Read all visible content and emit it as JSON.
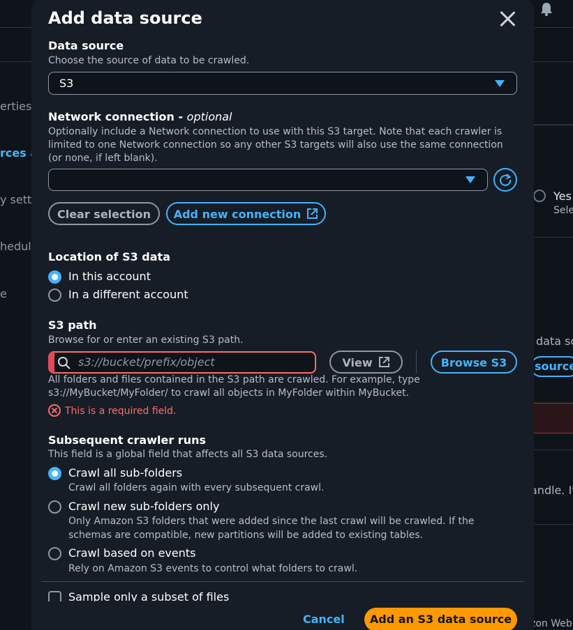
{
  "background": {
    "sidebar_items": [
      "erties",
      "rces an",
      "y setti",
      "hedul",
      "e"
    ],
    "yes_label": "Yes",
    "sel_label": "Sele",
    "data_so_label": "data so",
    "source_button": "source",
    "handle_text": "andle. If",
    "footer_text": "zon Web"
  },
  "modal": {
    "title": "Add data source",
    "data_source": {
      "label": "Data source",
      "description": "Choose the source of data to be crawled.",
      "value": "S3"
    },
    "network": {
      "label": "Network connection - ",
      "label_optional": "optional",
      "description": "Optionally include a Network connection to use with this S3 target. Note that each crawler is limited to one Network connection so any other S3 targets will also use the same connection (or none, if left blank).",
      "value": "",
      "clear_button": "Clear selection",
      "add_button": "Add new connection"
    },
    "location": {
      "label": "Location of S3 data",
      "options": [
        "In this account",
        "In a different account"
      ],
      "selected": "In this account"
    },
    "s3_path": {
      "label": "S3 path",
      "description": "Browse for or enter an existing S3 path.",
      "placeholder": "s3://bucket/prefix/object",
      "value": "",
      "view_button": "View",
      "browse_button": "Browse S3",
      "help": "All folders and files contained in the S3 path are crawled. For example, type s3://MyBucket/MyFolder/ to crawl all objects in MyFolder within MyBucket.",
      "error": "This is a required field."
    },
    "subsequent": {
      "label": "Subsequent crawler runs",
      "description": "This field is a global field that affects all S3 data sources.",
      "options": [
        {
          "label": "Crawl all sub-folders",
          "desc": "Crawl all folders again with every subsequent crawl."
        },
        {
          "label": "Crawl new sub-folders only",
          "desc": "Only Amazon S3 folders that were added since the last crawl will be crawled. If the schemas are compatible, new partitions will be added to existing tables."
        },
        {
          "label": "Crawl based on events",
          "desc": "Rely on Amazon S3 events to control what folders to crawl."
        }
      ],
      "selected": "Crawl all sub-folders"
    },
    "sample_subset_label": "Sample only a subset of files",
    "cancel_button": "Cancel",
    "primary_button": "Add an S3 data source"
  },
  "colors": {
    "accent": "#42b4ff",
    "primary_button": "#ff9900",
    "error": "#ff6b6b",
    "modal_bg": "#161d26",
    "page_bg": "#0f141a"
  },
  "icons": [
    "close-icon",
    "caret-down-icon",
    "refresh-icon",
    "external-link-icon",
    "search-icon",
    "error-icon",
    "bell-icon"
  ]
}
